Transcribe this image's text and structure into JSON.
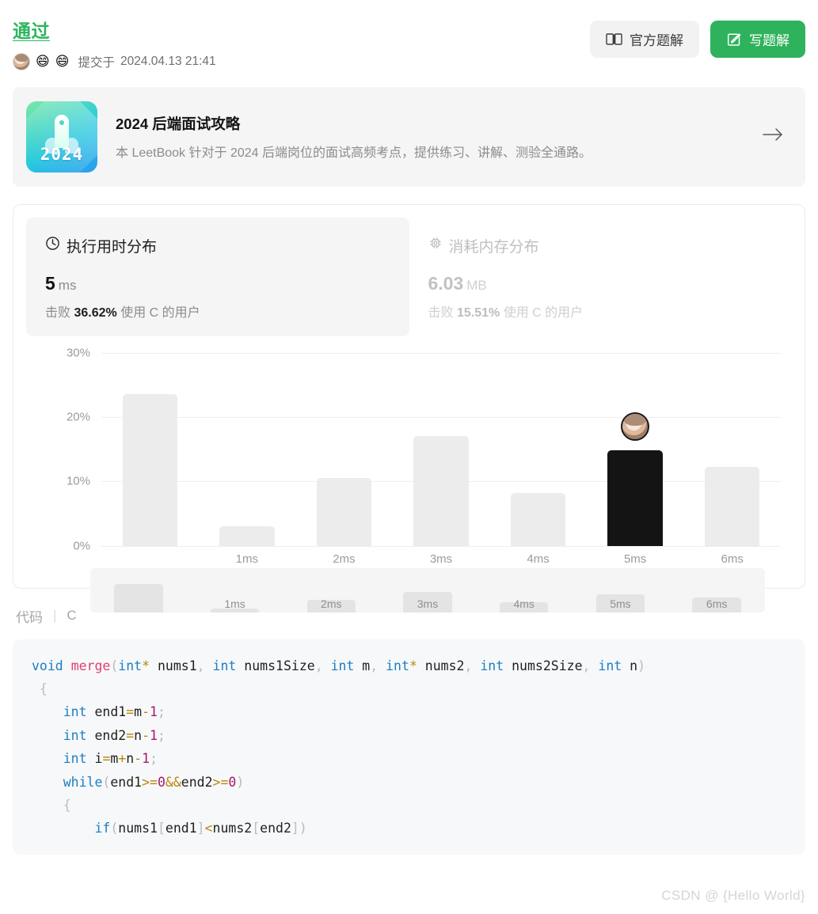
{
  "header": {
    "status": "通过",
    "submitted_prefix": "提交于",
    "submitted_at": "2024.04.13 21:41",
    "emojis": [
      "😄",
      "😄"
    ],
    "buttons": {
      "official_solution": "官方题解",
      "write_solution": "写题解"
    }
  },
  "banner": {
    "thumb_year": "2024",
    "title": "2024 后端面试攻略",
    "subtitle": "本 LeetBook 针对于 2024 后端岗位的面试高频考点，提供练习、讲解、测验全通路。",
    "arrow_icon": "arrow-right-icon"
  },
  "stats": {
    "runtime": {
      "icon": "clock-icon",
      "title": "执行用时分布",
      "value": "5",
      "unit": "ms",
      "beat_prefix": "击败",
      "beat_percent": "36.62%",
      "beat_suffix": "使用 C 的用户"
    },
    "memory": {
      "icon": "chip-icon",
      "title": "消耗内存分布",
      "value": "6.03",
      "unit": "MB",
      "beat_prefix": "击败",
      "beat_percent": "15.51%",
      "beat_suffix": "使用 C 的用户"
    }
  },
  "chart_data": {
    "type": "bar",
    "title": "执行用时分布",
    "xlabel": "",
    "ylabel": "",
    "ylim": [
      0,
      30
    ],
    "yticks": [
      0,
      10,
      20,
      30
    ],
    "ytick_labels": [
      "0%",
      "10%",
      "20%",
      "30%"
    ],
    "grid": true,
    "legend": null,
    "categories": [
      "0ms",
      "1ms",
      "2ms",
      "3ms",
      "4ms",
      "5ms",
      "6ms"
    ],
    "tick_labels": [
      "",
      "1ms",
      "2ms",
      "3ms",
      "4ms",
      "5ms",
      "6ms"
    ],
    "values": [
      23.5,
      3.0,
      10.5,
      17.0,
      8.2,
      14.8,
      12.3
    ],
    "highlight_index": 5,
    "highlight_label": "5ms",
    "bar_color": "#ececec",
    "highlight_color": "#141414",
    "avatar_marker": true,
    "minimap": {
      "categories": [
        "0ms",
        "1ms",
        "2ms",
        "3ms",
        "4ms",
        "5ms",
        "6ms"
      ],
      "tick_labels": [
        "",
        "1ms",
        "2ms",
        "3ms",
        "4ms",
        "5ms",
        "6ms"
      ],
      "values": [
        23.5,
        3.0,
        10.5,
        17.0,
        8.2,
        14.8,
        12.3
      ]
    }
  },
  "code_section": {
    "label": "代码",
    "separator": "|",
    "language": "C"
  },
  "watermark": "CSDN @ {Hello World}",
  "colors": {
    "success": "#2db55d",
    "primary_button": "#2eb25b",
    "bar": "#ececec",
    "bar_highlight": "#141414"
  }
}
